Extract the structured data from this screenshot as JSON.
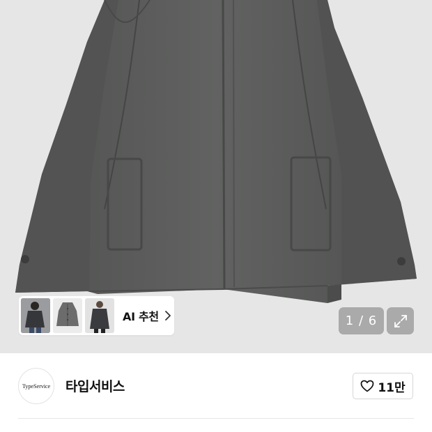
{
  "hero": {
    "image_description_icon": "product-image",
    "page_counter": "1 / 6"
  },
  "ai_recommend": {
    "label": "AI 추천",
    "thumbnails": [
      "thumb-model-wearing-coat",
      "thumb-gray-coat-front",
      "thumb-dark-coat-model"
    ]
  },
  "seller": {
    "logo_text": "TypeService",
    "name": "타입서비스",
    "like_count": "11만"
  },
  "colors": {
    "coat": "#5b5c5b",
    "background": "#e6e6e6",
    "counter_bg": "#8a8a8a"
  }
}
